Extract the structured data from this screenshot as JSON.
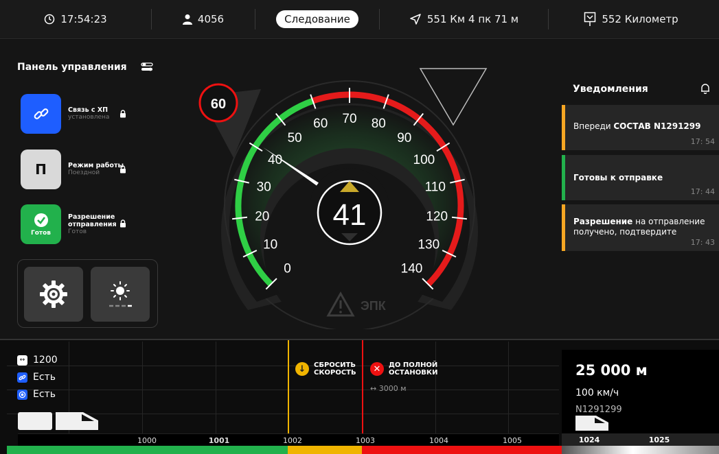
{
  "status_bar": {
    "time": "17:54:23",
    "driver_id": "4056",
    "mode": "Следование",
    "position": "551 Км 4 пк 71 м",
    "next_point": "552 Километр"
  },
  "control_panel": {
    "title": "Панель управления",
    "items": [
      {
        "title": "Связь с ХП",
        "status": "установлена",
        "color": "#1e5eff"
      },
      {
        "title": "Режим работы",
        "status": "Поездной",
        "tile_letter": "П",
        "color": "#d9d9d9"
      },
      {
        "title_line1": "Разрешение",
        "title_line2": "отправления",
        "status": "Готов",
        "tile_label": "Готов",
        "color": "#22b14c"
      }
    ]
  },
  "speedometer": {
    "current_speed": "41",
    "speed_limit": "60",
    "min": 0,
    "max": 140,
    "ticks": [
      "0",
      "10",
      "20",
      "30",
      "40",
      "50",
      "60",
      "70",
      "80",
      "90",
      "100",
      "110",
      "120",
      "130",
      "140"
    ],
    "green_until": 60,
    "epk_label": "ЭПК"
  },
  "notifications": {
    "title": "Уведомления",
    "items": [
      {
        "prefix": "Впереди ",
        "bold": "СОСТАВ N1291299",
        "suffix": "",
        "time": "17: 54",
        "color": "#f5a623"
      },
      {
        "prefix": "",
        "bold": "Готовы к отправке",
        "suffix": "",
        "time": "17: 44",
        "color": "#22b14c"
      },
      {
        "prefix": "",
        "bold": "Разрешение",
        "suffix": " на отправление получено, подтвердите",
        "time": "17: 43",
        "color": "#f5a623"
      }
    ]
  },
  "bottom": {
    "train_length": "1200",
    "link_status": "Есть",
    "signal_status": "Есть",
    "marker_reduce": {
      "line1": "СБРОСИТЬ",
      "line2": "СКОРОСТЬ"
    },
    "marker_stop": {
      "line1": "ДО ПОЛНОЙ",
      "line2": "ОСТАНОВКИ",
      "distance": "3000 м"
    },
    "scale": [
      "1000",
      "1001",
      "1002",
      "1003",
      "1004",
      "1005"
    ],
    "target_distance": "25 000 м",
    "target_speed": "100 км/ч",
    "target_train": "N1291299",
    "right_scale": [
      "1024",
      "1025"
    ]
  }
}
